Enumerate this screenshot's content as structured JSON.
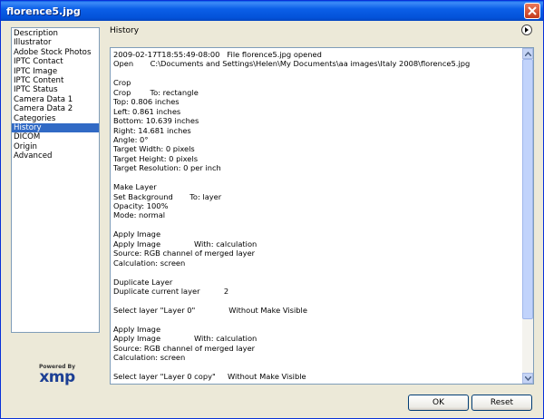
{
  "window": {
    "title": "florence5.jpg"
  },
  "sidebar": {
    "items": [
      {
        "label": "Description"
      },
      {
        "label": "Illustrator"
      },
      {
        "label": "Adobe Stock Photos"
      },
      {
        "label": "IPTC Contact"
      },
      {
        "label": "IPTC Image"
      },
      {
        "label": "IPTC Content"
      },
      {
        "label": "IPTC Status"
      },
      {
        "label": "Camera Data 1"
      },
      {
        "label": "Camera Data 2"
      },
      {
        "label": "Categories"
      },
      {
        "label": "History",
        "selected": true
      },
      {
        "label": "DICOM"
      },
      {
        "label": "Origin"
      },
      {
        "label": "Advanced"
      }
    ]
  },
  "logo": {
    "powered": "Powered By",
    "brand": "xmp"
  },
  "panel": {
    "title": "History"
  },
  "history": {
    "lines": [
      "2009-02-17T18:55:49-08:00   File florence5.jpg opened",
      "Open       C:\\Documents and Settings\\Helen\\My Documents\\aa images\\Italy 2008\\florence5.jpg",
      "",
      "Crop",
      "Crop        To: rectangle",
      "Top: 0.806 inches",
      "Left: 0.861 inches",
      "Bottom: 10.639 inches",
      "Right: 14.681 inches",
      "Angle: 0°",
      "Target Width: 0 pixels",
      "Target Height: 0 pixels",
      "Target Resolution: 0 per inch",
      "",
      "Make Layer",
      "Set Background       To: layer",
      "Opacity: 100%",
      "Mode: normal",
      "",
      "Apply Image",
      "Apply Image              With: calculation",
      "Source: RGB channel of merged layer",
      "Calculation: screen",
      "",
      "Duplicate Layer",
      "Duplicate current layer          2",
      "",
      "Select layer \"Layer 0\"              Without Make Visible",
      "",
      "Apply Image",
      "Apply Image              With: calculation",
      "Source: RGB channel of merged layer",
      "Calculation: screen",
      "",
      "Select layer \"Layer 0 copy\"     Without Make Visible"
    ]
  },
  "buttons": {
    "ok": "OK",
    "reset": "Reset"
  },
  "colors": {
    "titlebar": "#0b5fe8",
    "selection": "#316ac5",
    "dialog_bg": "#ece9d8"
  },
  "icons": {
    "close": "close-icon",
    "menu": "flyout-menu-icon",
    "scroll_up": "arrow-up-icon",
    "scroll_down": "arrow-down-icon"
  }
}
